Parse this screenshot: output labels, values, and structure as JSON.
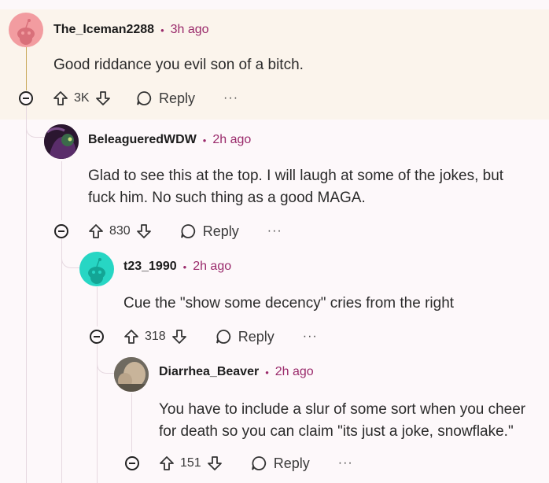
{
  "comments": [
    {
      "username": "The_Iceman2288",
      "time": "3h ago",
      "body": "Good riddance you evil son of a bitch.",
      "score": "3K",
      "reply_label": "Reply",
      "more_label": "···",
      "avatar_color": "#f29ca0"
    },
    {
      "username": "BeleagueredWDW",
      "time": "2h ago",
      "body": "Glad to see this at the top. I will laugh at some of the jokes, but fuck him. No such thing as a good MAGA.",
      "score": "830",
      "reply_label": "Reply",
      "more_label": "···",
      "avatar_color": "#2b1630"
    },
    {
      "username": "t23_1990",
      "time": "2h ago",
      "body": "Cue the \"show some decency\" cries from the right",
      "score": "318",
      "reply_label": "Reply",
      "more_label": "···",
      "avatar_color": "#27d6c4"
    },
    {
      "username": "Diarrhea_Beaver",
      "time": "2h ago",
      "body": "You have to include a slur of some sort when you cheer for death so you can claim \"its just a joke, snowflake.\"",
      "score": "151",
      "reply_label": "Reply",
      "more_label": "···",
      "avatar_color": "#8a7a6a"
    }
  ],
  "separator": "•",
  "colors": {
    "highlight_bg": "#fbf4ec",
    "timestamp": "#9a2a6b",
    "thread_line": "#e6d8e0"
  }
}
